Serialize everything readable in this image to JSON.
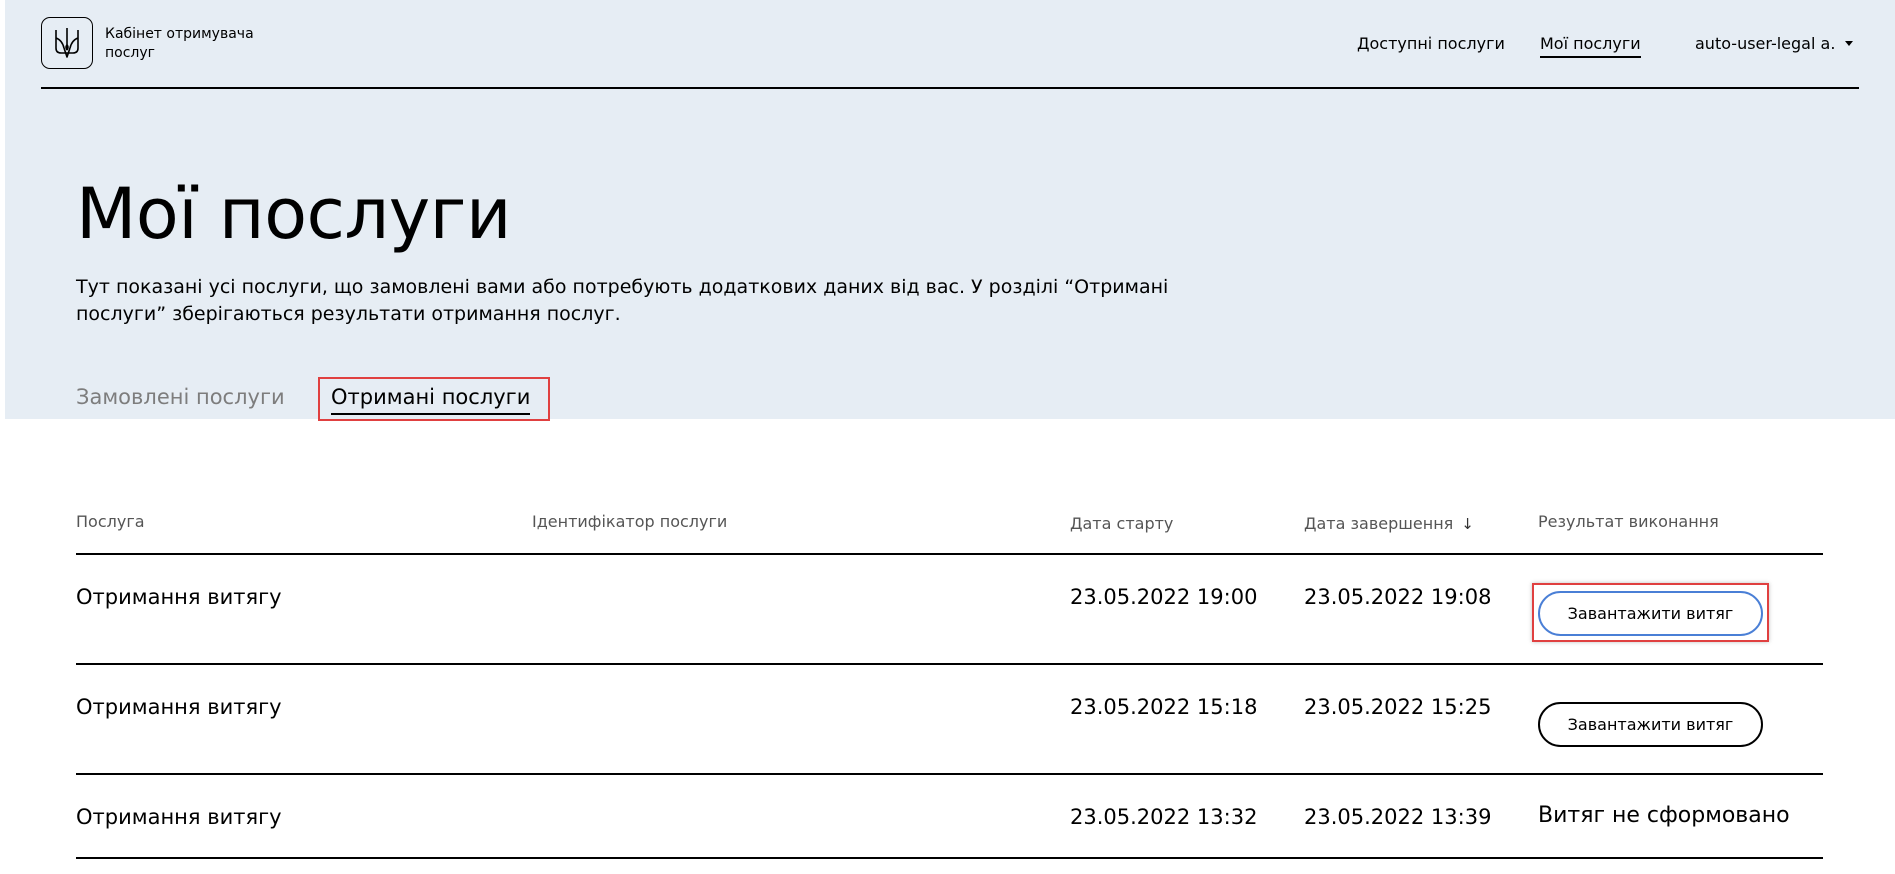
{
  "header": {
    "logo_text": "Кабінет отримувача послуг",
    "nav": {
      "available_services": "Доступні послуги",
      "my_services": "Мої послуги"
    },
    "user": "auto-user-legal a."
  },
  "main": {
    "title": "Мої послуги",
    "description": "Тут показані усі послуги, що замовлені вами або потребують додаткових даних від вас. У розділі “Отримані послуги” зберігаються результати отримання послуг.",
    "tabs": {
      "ordered": "Замовлені послуги",
      "received": "Отримані послуги"
    }
  },
  "table": {
    "headers": {
      "service": "Послуга",
      "service_id": "Ідентифікатор послуги",
      "start_date": "Дата старту",
      "end_date": "Дата завершення",
      "result": "Результат виконання"
    },
    "rows": [
      {
        "service": "Отримання витягу",
        "service_id": "",
        "start": "23.05.2022 19:00",
        "end": "23.05.2022 19:08",
        "result_button": "Завантажити витяг"
      },
      {
        "service": "Отримання витягу",
        "service_id": "",
        "start": "23.05.2022 15:18",
        "end": "23.05.2022 15:25",
        "result_button": "Завантажити витяг"
      },
      {
        "service": "Отримання витягу",
        "service_id": "",
        "start": "23.05.2022 13:32",
        "end": "23.05.2022 13:39",
        "result_text": "Витяг не сформовано"
      }
    ]
  },
  "colors": {
    "hero_background": "#e6edf4",
    "highlight": "#e04040",
    "focus_ring": "#4a7fd6",
    "muted_text": "#7d7d7d"
  },
  "icons": {
    "logo": "trident-icon",
    "user_menu": "caret-down-icon",
    "sort": "arrow-down-icon"
  }
}
